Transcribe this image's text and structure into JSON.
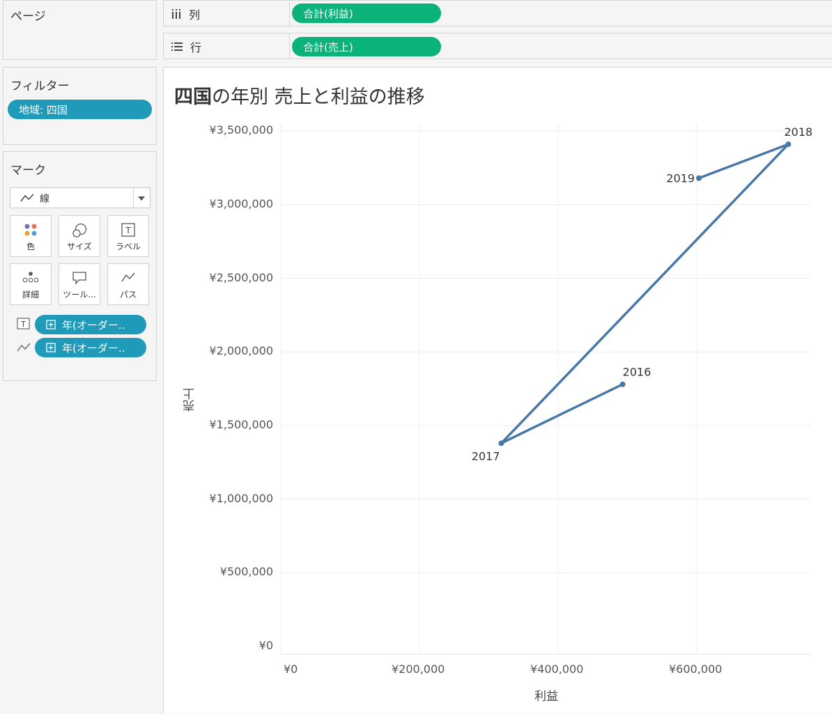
{
  "pages_panel": {
    "title": "ページ"
  },
  "columns_shelf": {
    "label": "列",
    "pill": "合計(利益)"
  },
  "rows_shelf": {
    "label": "行",
    "pill": "合計(売上)"
  },
  "filters_panel": {
    "title": "フィルター",
    "pill": "地域: 四国"
  },
  "marks_panel": {
    "title": "マーク",
    "mark_type": "線",
    "cards": [
      {
        "label": "色",
        "icon": "color-icon"
      },
      {
        "label": "サイズ",
        "icon": "size-icon"
      },
      {
        "label": "ラベル",
        "icon": "label-icon"
      },
      {
        "label": "詳細",
        "icon": "detail-icon"
      },
      {
        "label": "ツール...",
        "icon": "tooltip-icon"
      },
      {
        "label": "パス",
        "icon": "path-icon"
      }
    ],
    "fields": [
      {
        "icon": "label-icon",
        "text": "年(オーダー.."
      },
      {
        "icon": "path-icon",
        "text": "年(オーダー.."
      }
    ]
  },
  "chart_title": {
    "bold": "四国",
    "rest": "の年別 売上と利益の推移"
  },
  "chart_data": {
    "type": "line",
    "title": "四国の年別 売上と利益の推移",
    "xlabel": "利益",
    "ylabel": "売上",
    "x_ticks": [
      "¥0",
      "¥200,000",
      "¥400,000",
      "¥600,000"
    ],
    "y_ticks": [
      "¥0",
      "¥500,000",
      "¥1,000,000",
      "¥1,500,000",
      "¥2,000,000",
      "¥2,500,000",
      "¥3,000,000",
      "¥3,500,000"
    ],
    "xlim": [
      0,
      750000
    ],
    "ylim": [
      0,
      3500000
    ],
    "grid": true,
    "color": "#4a78a6",
    "points": [
      {
        "label": "2016",
        "x": 493000,
        "y": 1780000
      },
      {
        "label": "2017",
        "x": 318000,
        "y": 1380000
      },
      {
        "label": "2018",
        "x": 732000,
        "y": 3410000
      },
      {
        "label": "2019",
        "x": 603000,
        "y": 3180000
      }
    ]
  }
}
